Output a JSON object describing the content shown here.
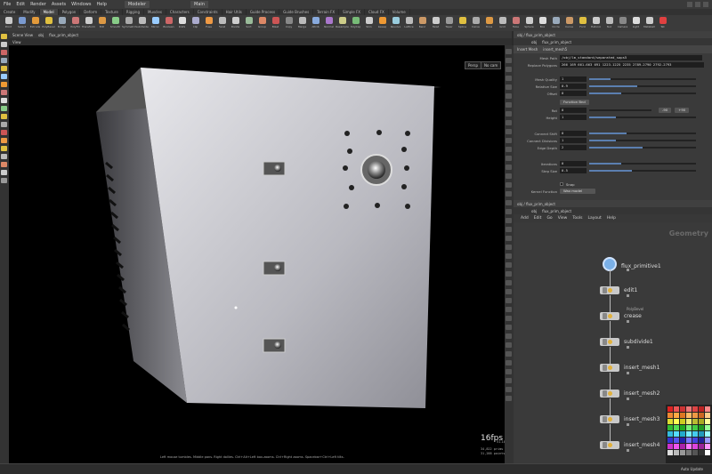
{
  "menu": {
    "items": [
      "File",
      "Edit",
      "Render",
      "Assets",
      "Windows",
      "Help"
    ],
    "desktop": "Modeler",
    "main": "Main"
  },
  "shelf_tabs": [
    "Create",
    "Modify",
    "Model",
    "Polygon",
    "Deform",
    "Texture",
    "Rigging",
    "Muscles",
    "Characters",
    "Constraints",
    "Hair Utils",
    "Guide Process",
    "Guide Brushes",
    "Terrain FX",
    "Simple FX",
    "Cloud FX",
    "Volume"
  ],
  "shelf_tools": [
    {
      "label": "Point",
      "color": "#c9c9c9"
    },
    {
      "label": "Select",
      "color": "#7a9ad0"
    },
    {
      "label": "Extrude",
      "color": "#e29a3b"
    },
    {
      "label": "PolyBevel",
      "color": "#e0c040"
    },
    {
      "label": "Bridge",
      "color": "#9ab"
    },
    {
      "label": "PolyFill",
      "color": "#c77"
    },
    {
      "label": "Transform",
      "color": "#ccc"
    },
    {
      "label": "Edit",
      "color": "#d94"
    },
    {
      "label": "Smooth",
      "color": "#8c8"
    },
    {
      "label": "Symmetrize",
      "color": "#aaa"
    },
    {
      "label": "Subdivide",
      "color": "#bbb"
    },
    {
      "label": "Mirror",
      "color": "#9cf"
    },
    {
      "label": "Boolean",
      "color": "#c66"
    },
    {
      "label": "Knife",
      "color": "#ddd"
    },
    {
      "label": "Clip",
      "color": "#aac"
    },
    {
      "label": "Fuse",
      "color": "#e94"
    },
    {
      "label": "Facet",
      "color": "#bbb"
    },
    {
      "label": "Divide",
      "color": "#ccc"
    },
    {
      "label": "Sort",
      "color": "#9b9"
    },
    {
      "label": "Group",
      "color": "#d86"
    },
    {
      "label": "Blast",
      "color": "#c55"
    },
    {
      "label": "Copy",
      "color": "#888"
    },
    {
      "label": "Merge",
      "color": "#bbb"
    },
    {
      "label": "Attrib",
      "color": "#8ad"
    },
    {
      "label": "Normal",
      "color": "#a7c"
    },
    {
      "label": "Resample",
      "color": "#cc8"
    },
    {
      "label": "PolyCap",
      "color": "#7b7"
    },
    {
      "label": "Skin",
      "color": "#ccc"
    },
    {
      "label": "Sweep",
      "color": "#e93"
    },
    {
      "label": "Revolve",
      "color": "#9cd"
    },
    {
      "label": "Lattice",
      "color": "#bbb"
    },
    {
      "label": "Bend",
      "color": "#c96"
    },
    {
      "label": "Twist",
      "color": "#ccc"
    },
    {
      "label": "Taper",
      "color": "#999"
    },
    {
      "label": "Spline",
      "color": "#e0c040"
    },
    {
      "label": "Carve",
      "color": "#aaa"
    },
    {
      "label": "Torus",
      "color": "#d94"
    },
    {
      "label": "Grid",
      "color": "#bbb"
    },
    {
      "label": "Tube",
      "color": "#c77"
    },
    {
      "label": "Sphere",
      "color": "#ccc"
    },
    {
      "label": "Box",
      "color": "#ddd"
    },
    {
      "label": "Circle",
      "color": "#9ab"
    },
    {
      "label": "Curve",
      "color": "#c96"
    },
    {
      "label": "Font",
      "color": "#e0c040"
    },
    {
      "label": "Platonic",
      "color": "#ccc"
    },
    {
      "label": "Null",
      "color": "#bbb"
    },
    {
      "label": "Camera",
      "color": "#888"
    },
    {
      "label": "Light",
      "color": "#ddd"
    },
    {
      "label": "Metaball",
      "color": "#ccc"
    },
    {
      "label": "Tet",
      "color": "#e04040"
    }
  ],
  "viewport": {
    "tab": "Scene View",
    "path_obj": "obj",
    "path_node": "flux_prim_object",
    "view_label": "View",
    "persp": "Persp",
    "cam": "No cam",
    "fps": "16fps",
    "time": "51.18ms",
    "stats": [
      "34,822 prims",
      "31,288 points"
    ],
    "hint": "Left mouse tumbles. Middle pans. Right dollies. Ctrl+Alt+Left box-zooms. Ctrl+Right zooms. Spacebar+Ctrl+Left tilts."
  },
  "params": {
    "tab": "obj / flux_prim_object",
    "path_obj": "obj",
    "path_node": "flux_prim_object",
    "node_type": "Insert Mesh",
    "node_name": "insert_mesh5",
    "mesh_path_label": "Mesh Path",
    "mesh_path_value": "/obj/lm_standard/separated_sops5",
    "replace_label": "Replace Polygons",
    "replace_value": "266 169 661-663 691 1223-1225 2235 2789-2790 2792-2793",
    "rows": [
      {
        "label": "Mesh Quality",
        "value": "1",
        "fill": 0.2
      },
      {
        "label": "Relative Size",
        "value": "0.9",
        "fill": 0.45
      },
      {
        "label": "Offset",
        "value": "0",
        "fill": 0.3
      }
    ],
    "button_label": "Function Bnd",
    "rot_label": "Rot",
    "rot_value": "0",
    "rot_minus": "-90",
    "rot_plus": "+90",
    "height_label": "Height",
    "height_value": "1",
    "rows2": [
      {
        "label": "Connect Shift",
        "value": "0",
        "fill": 0.35
      },
      {
        "label": "Connect Divisions",
        "value": "1",
        "fill": 0.25
      },
      {
        "label": "Edge Depth",
        "value": "2",
        "fill": 0.5
      }
    ],
    "rows3": [
      {
        "label": "Iterations",
        "value": "0",
        "fill": 0.3
      },
      {
        "label": "Step Size",
        "value": "0.5",
        "fill": 0.4
      }
    ],
    "snap_label": "Snap",
    "kernel_label": "Kernel Function",
    "kernel_value": "Wax model"
  },
  "network": {
    "tab": "obj / flux_prim_object",
    "path_obj": "obj",
    "path_node": "flux_prim_object",
    "menu": [
      "Add",
      "Edit",
      "Go",
      "View",
      "Tools",
      "Layout",
      "Help"
    ],
    "context": "Geometry",
    "nodes": [
      {
        "name": "flux_primitive1",
        "sub": ""
      },
      {
        "name": "edit1",
        "sub": ""
      },
      {
        "name": "crease",
        "sub": "PolyBevel"
      },
      {
        "name": "subdivide1",
        "sub": ""
      },
      {
        "name": "insert_mesh1",
        "sub": ""
      },
      {
        "name": "insert_mesh2",
        "sub": ""
      },
      {
        "name": "insert_mesh3",
        "sub": ""
      },
      {
        "name": "insert_mesh4",
        "sub": ""
      }
    ]
  },
  "timeline": {
    "auto_update": "Auto Update"
  },
  "swatch_colors": [
    "#d22",
    "#e55",
    "#c33",
    "#e77",
    "#d44",
    "#b22",
    "#f88",
    "#e83",
    "#fa4",
    "#d72",
    "#fb6",
    "#e94",
    "#c62",
    "#fc8",
    "#dd3",
    "#ff5",
    "#cc2",
    "#ee7",
    "#bb3",
    "#aa2",
    "#ff9",
    "#3b3",
    "#5d5",
    "#2a2",
    "#7e7",
    "#4c4",
    "#292",
    "#9f9",
    "#3bd",
    "#5df",
    "#2ac",
    "#7ef",
    "#4ce",
    "#29b",
    "#9ff",
    "#33c",
    "#55e",
    "#22a",
    "#77f",
    "#44d",
    "#229",
    "#99f",
    "#c3c",
    "#e5e",
    "#a2a",
    "#f7f",
    "#d4d",
    "#929",
    "#f9f",
    "#ddd",
    "#bbb",
    "#999",
    "#777",
    "#555",
    "#333",
    "#fff"
  ]
}
